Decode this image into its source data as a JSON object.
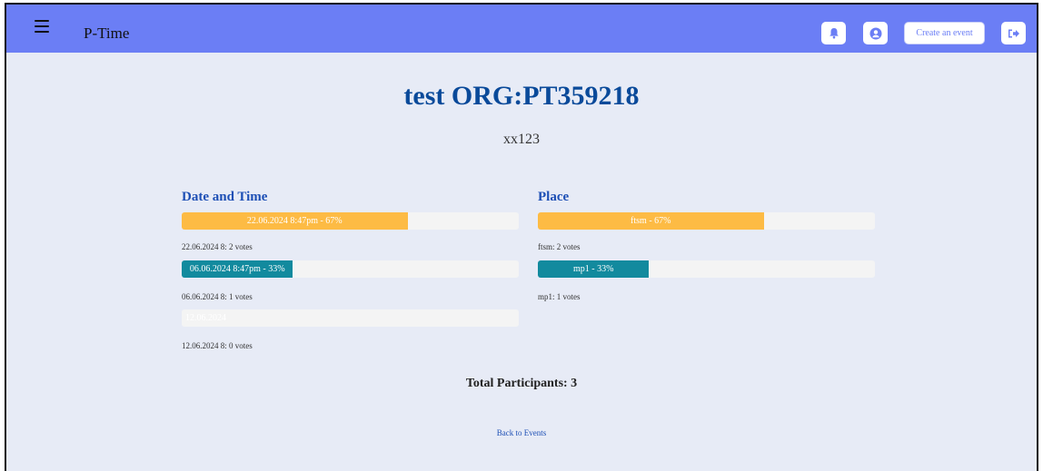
{
  "navbar": {
    "brand": "P-Time",
    "create_event_label": "Create an event",
    "icons": [
      "bell-icon",
      "user-circle-icon",
      "logout-icon"
    ],
    "bg_color": "#6b7ef5"
  },
  "event": {
    "title": "test ORG:PT359218",
    "subtitle": "xx123"
  },
  "date_section": {
    "title": "Date and Time",
    "options": [
      {
        "bar_label": "22.06.2024 8:47pm - 67%",
        "percent": 67,
        "color": "#fdbb44",
        "votes_text": "22.06.2024 8: 2 votes"
      },
      {
        "bar_label": "06.06.2024 8:47pm - 33%",
        "percent": 33,
        "color": "#128a9e",
        "votes_text": "06.06.2024 8: 1 votes"
      },
      {
        "bar_label": "12.06.2024",
        "percent": 0,
        "color": "#f4f4f4",
        "votes_text": "12.06.2024 8: 0 votes"
      }
    ]
  },
  "place_section": {
    "title": "Place",
    "options": [
      {
        "bar_label": "ftsm - 67%",
        "percent": 67,
        "color": "#fdbb44",
        "votes_text": "ftsm: 2 votes"
      },
      {
        "bar_label": "mp1 - 33%",
        "percent": 33,
        "color": "#128a9e",
        "votes_text": "mp1: 1 votes"
      }
    ]
  },
  "total_participants": "Total Participants: 3",
  "back_link": "Back to Events"
}
